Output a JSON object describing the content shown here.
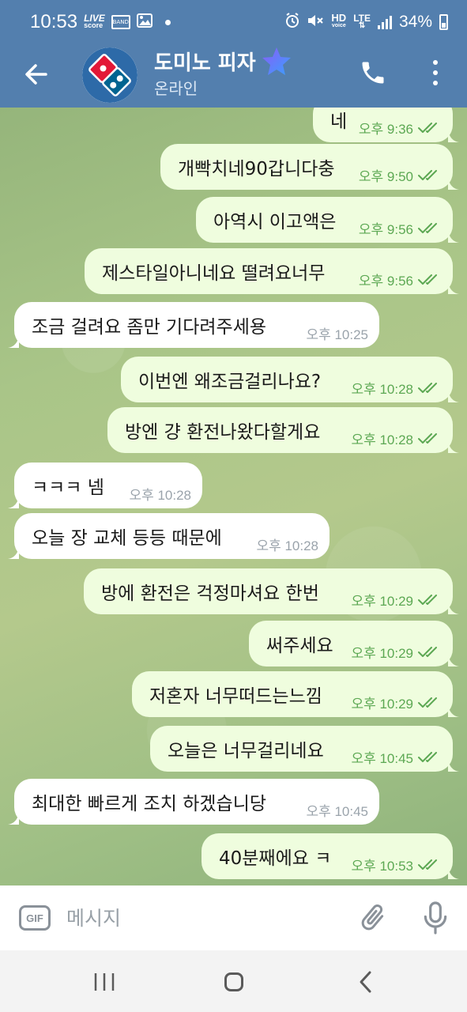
{
  "status_bar": {
    "time": "10:53",
    "live_line1": "LIVE",
    "live_line2": "score",
    "app_badge": "BAND",
    "hd_line1": "HD",
    "hd_line2": "voice",
    "lte": "LTE",
    "battery": "34%"
  },
  "header": {
    "title": "도미노 피자",
    "status": "온라인",
    "accent": "#537fae",
    "premium_star_colors": [
      "#8a5cf6",
      "#3aa0ff"
    ]
  },
  "messages": [
    {
      "dir": "out",
      "text": "네",
      "time": "오후 9:36",
      "read": true
    },
    {
      "dir": "out",
      "text": "개빡치네90갑니다충",
      "time": "오후 9:50",
      "read": true
    },
    {
      "dir": "out",
      "text": "아역시 이고액은",
      "time": "오후 9:56",
      "read": true
    },
    {
      "dir": "out",
      "text": "제스타일아니네요 떨려요너무",
      "time": "오후 9:56",
      "read": true
    },
    {
      "dir": "in",
      "text": "조금 걸려요 좀만 기다려주세용",
      "time": "오후 10:25"
    },
    {
      "dir": "out",
      "text": "이번엔 왜조금걸리나요?",
      "time": "오후 10:28",
      "read": true
    },
    {
      "dir": "out",
      "text": "방엔 걍 환전나왔다할게요",
      "time": "오후 10:28",
      "read": true
    },
    {
      "dir": "in",
      "text": "ㅋㅋㅋ 넴",
      "time": "오후 10:28"
    },
    {
      "dir": "in",
      "text": "오늘 장 교체 등등 때문에",
      "time": "오후 10:28"
    },
    {
      "dir": "out",
      "text": "방에 환전은 걱정마셔요 한번",
      "time": "오후 10:29",
      "read": true
    },
    {
      "dir": "out",
      "text": "써주세요",
      "time": "오후 10:29",
      "read": true
    },
    {
      "dir": "out",
      "text": "저혼자 너무떠드는느낌",
      "time": "오후 10:29",
      "read": true
    },
    {
      "dir": "out",
      "text": "오늘은 너무걸리네요",
      "time": "오후 10:45",
      "read": true
    },
    {
      "dir": "in",
      "text": "최대한 빠르게 조치 하겠습니당",
      "time": "오후 10:45"
    },
    {
      "dir": "out",
      "text": "40분째에요 ㅋ",
      "time": "오후 10:53",
      "read": true
    }
  ],
  "input": {
    "gif_label": "GIF",
    "placeholder": "메시지"
  },
  "colors": {
    "outgoing_bubble": "#effdde",
    "incoming_bubble": "#ffffff",
    "read_check": "#5ca853"
  }
}
